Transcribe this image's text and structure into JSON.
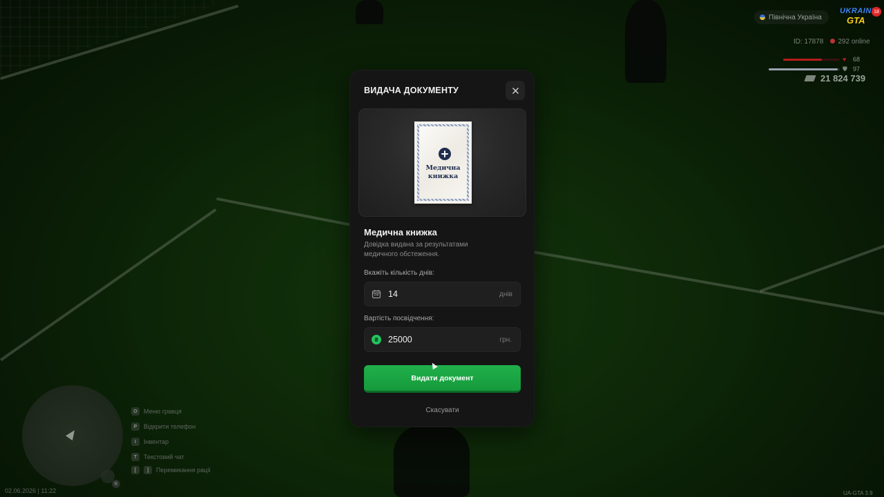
{
  "hud": {
    "server_name": "Північна Україна",
    "logo_line1": "UKRAINE",
    "logo_line2": "GTA",
    "logo_badge": "18",
    "player_id": "ID: 17878",
    "online": "292 online",
    "health": 68,
    "armor": 97,
    "health_label": "68",
    "armor_label": "97",
    "money": "21 824 739",
    "colors": {
      "health": "#b91c1c",
      "armor": "#9ca3af",
      "online_dot": "#b33333"
    }
  },
  "hints": [
    {
      "key": "O",
      "label": "Меню гравця"
    },
    {
      "key": "P",
      "label": "Відкрити телефон"
    },
    {
      "key": "I",
      "label": "Інвентар"
    },
    {
      "key": "T",
      "label": "Текстовий чат"
    },
    {
      "key": "[",
      "key2": "]",
      "label": "Перемикання рації"
    }
  ],
  "mic_key": "B",
  "datetime": "02.06.2026 | 11:22",
  "version": "UA-GTA 3.9",
  "modal": {
    "title": "ВИДАЧА ДОКУМЕНТУ",
    "close_icon": "close-icon",
    "document_card_line1": "Медична",
    "document_card_line2": "книжка",
    "document_name": "Медична книжка",
    "document_description": "Довідка видана за результатами медичного обстеження.",
    "days_label": "Вкажіть кількість днів:",
    "days_value": "14",
    "days_unit": "днів",
    "days_icon": "calendar-icon",
    "cost_label": "Вартість посвідчення:",
    "cost_value": "25000",
    "cost_unit": "грн.",
    "cost_icon": "hryvnia-coin-icon",
    "coin_symbol": "₴",
    "submit_label": "Видати документ",
    "cancel_label": "Скасувати",
    "colors": {
      "accent": "#1fa845",
      "panel": "#151515",
      "doc_ink": "#1f2d4d"
    }
  }
}
